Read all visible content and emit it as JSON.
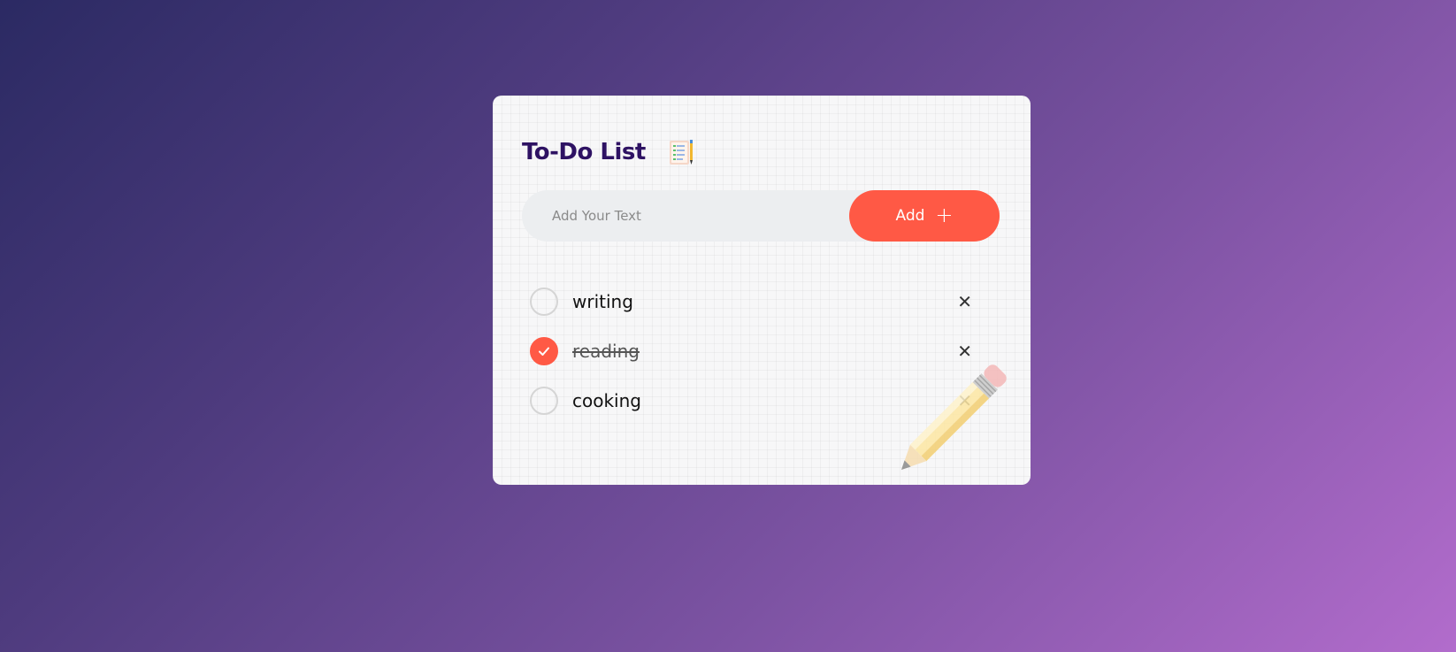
{
  "app": {
    "title": "To-Do List",
    "icon": "notepad-icon"
  },
  "input": {
    "placeholder": "Add Your Text",
    "value": ""
  },
  "add_button": {
    "label": "Add",
    "icon": "plus-icon"
  },
  "todos": [
    {
      "text": "writing",
      "completed": false
    },
    {
      "text": "reading",
      "completed": true
    },
    {
      "text": "cooking",
      "completed": false
    }
  ],
  "delete_icon": "close-icon",
  "decoration": "pencil-icon",
  "colors": {
    "accent": "#ff5945",
    "title": "#2e1263",
    "background_start": "#2b2a63",
    "background_end": "#b26ccc"
  }
}
